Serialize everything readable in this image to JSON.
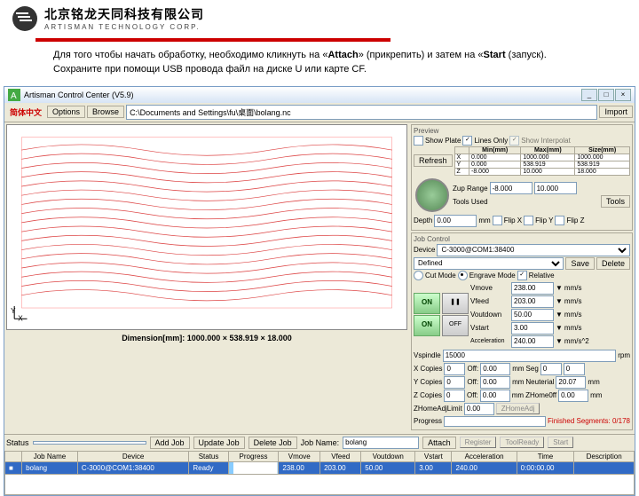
{
  "company": {
    "cn": "北京铭龙天同科技有限公司",
    "en": "ARTISMAN TECHNOLOGY CORP."
  },
  "intro": {
    "l1a": "Для того чтобы начать обработку, необходимо кликнуть на «",
    "l1b": "Attach",
    "l1c": "» (прикрепить) и затем на «",
    "l1d": "Start",
    "l1e": " (запуск).",
    "l2": "Сохраните при помощи USB провода файл на диске U или карте CF."
  },
  "title": "Artisman Control Center (V5.9)",
  "menu": {
    "chs": "简体中文",
    "options": "Options",
    "browse": "Browse",
    "path": "C:\\Documents and Settings\\fu\\桌面\\bolang.nc",
    "import": "Import"
  },
  "preview": {
    "label": "Preview",
    "show_plate": "Show Plate",
    "lines_only": "Lines Only",
    "interp": "Show Interpolat",
    "refresh": "Refresh",
    "hdr": [
      "",
      "Min(mm)",
      "Max(mm)",
      "Size(mm)"
    ],
    "x": {
      "a": "X",
      "min": "0.000",
      "max": "1000.000",
      "size": "1000.000"
    },
    "y": {
      "a": "Y",
      "min": "0.000",
      "max": "538.919",
      "size": "538.919"
    },
    "z": {
      "a": "Z",
      "min": "-8.000",
      "max": "10.000",
      "size": "18.000"
    },
    "zup": "Zup Range",
    "zmin": "-8.000",
    "zmax": "10.000",
    "depth_l": "Depth",
    "depth": "0.00",
    "mm": "mm",
    "tools_used": "Tools Used",
    "tools": "Tools",
    "flipx": "Flip X",
    "flipy": "Flip Y",
    "flipz": "Flip Z"
  },
  "job": {
    "label": "Job Control",
    "device_l": "Device",
    "device": "C-3000@COM1:38400",
    "save": "Save",
    "delete": "Delete",
    "defined": "Defined",
    "cut": "Cut Mode",
    "engrave": "Engrave Mode",
    "rel": "Relative",
    "on": "ON",
    "off": "OFF",
    "vmove_l": "Vmove",
    "vmove": "238.00",
    "vfeed_l": "Vfeed",
    "vfeed": "203.00",
    "voutdown_l": "Voutdown",
    "voutdown": "50.00",
    "vstart_l": "Vstart",
    "vstart": "3.00",
    "acc_l": "Acceleration",
    "acc": "240.00",
    "mms": "mm/s",
    "mms2": "mm/s^2",
    "vspindle_l": "Vspindle",
    "vspindle": "15000",
    "rpm": "rpm",
    "xc": "X Copies",
    "yc": "Y Copies",
    "zc": "Z Copies",
    "zero": "0",
    "off_l": "Off:",
    "ofv": "0.00",
    "seg": "Seg",
    "neu": "Neuterial",
    "neu_v": "20.07",
    "zhome": "ZHome0ff",
    "zadj": "ZHomeAdjLimit",
    "zhb": "ZHomeAdj",
    "prog": "Progress",
    "seg_t": "Finished Segments: 0/178"
  },
  "dim": "Dimension[mm]: 1000.000 × 538.919 × 18.000",
  "status": {
    "l": "Status",
    "addjob": "Add Job",
    "upd": "Update Job",
    "del": "Delete Job",
    "jn": "Job Name:",
    "jnv": "bolang",
    "attach": "Attach",
    "reg": "Register",
    "tool": "ToolReady",
    "start": "Start"
  },
  "tbl": {
    "h": [
      "",
      "Job Name",
      "Device",
      "Status",
      "Progress",
      "Vmove",
      "Vfeed",
      "Voutdown",
      "Vstart",
      "Acceleration",
      "Time",
      "Description"
    ],
    "r": [
      "■",
      "bolang",
      "C-3000@COM1:38400",
      "Ready",
      "",
      "238.00",
      "203.00",
      "50.00",
      "3.00",
      "240.00",
      "0:00:00.00",
      ""
    ]
  }
}
